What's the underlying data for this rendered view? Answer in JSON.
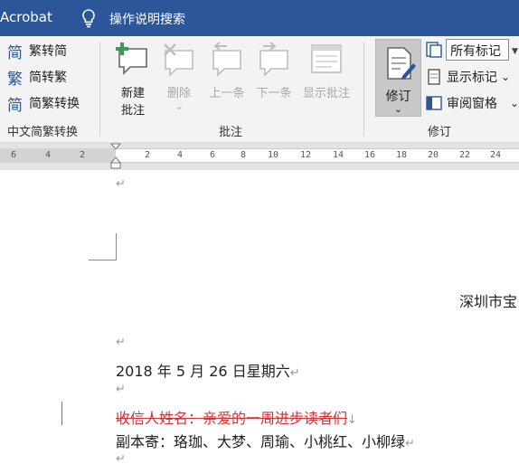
{
  "title_bar": {
    "app_name": "Acrobat",
    "tell_me": "操作说明搜索"
  },
  "ribbon": {
    "chinese_conversion": {
      "items": [
        "繁转简",
        "简转繁",
        "简繁转换"
      ],
      "icons": [
        "简",
        "繁",
        "简"
      ],
      "group_label": "中文简繁转换"
    },
    "comments": {
      "new_comment_lines": [
        "新建",
        "批注"
      ],
      "delete_label": "删除",
      "delete_caret": "⌄",
      "previous_label": "上一条",
      "next_label": "下一条",
      "show_comments_label": "显示批注",
      "group_label": "批注"
    },
    "tracking": {
      "track_changes_label": "修订",
      "track_changes_caret": "⌄",
      "markup_select": "所有标记",
      "show_markup": "显示标记",
      "reviewing_pane": "审阅窗格",
      "caret": "⌄",
      "group_label": "修订"
    }
  },
  "ruler": {
    "ticks": [
      "6",
      "4",
      "2",
      "2",
      "4",
      "6",
      "8",
      "10",
      "12",
      "14",
      "16",
      "18",
      "20",
      "22",
      "24"
    ]
  },
  "document": {
    "paragraph_mark": "↵",
    "recipient_address": "深圳市宝",
    "date_line": "2018 年 5 月 26 日星期六",
    "deleted_line": "收信人姓名：亲爱的一周进步读者们",
    "deleted_mark": "↓",
    "cc_line": "副本寄：珞珈、大梦、周瑜、小桃红、小柳绿"
  },
  "colors": {
    "title_bar": "#2b579a",
    "ribbon_bg": "#f3f3f3",
    "deleted_text": "#d13438",
    "track_changes_active": "#c8c8c8"
  }
}
